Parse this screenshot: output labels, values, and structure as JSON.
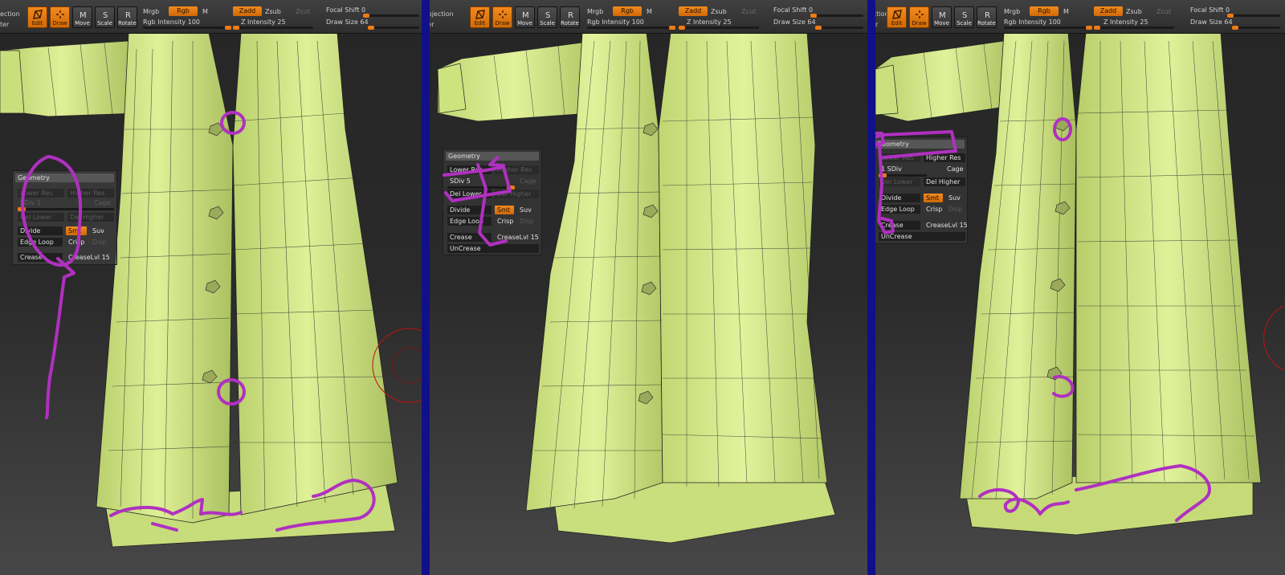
{
  "toolbar": {
    "projection": "ection",
    "projection_line2": "ter",
    "tools": {
      "edit": "Edit",
      "draw": "Draw",
      "move": "Move",
      "scale": "Scale",
      "rotate": "Rotate"
    },
    "mrgb": "Mrgb",
    "rgb": "Rgb",
    "m": "M",
    "zadd": "Zadd",
    "zsub": "Zsub",
    "zcut": "Zcut",
    "rgb_intensity": "Rgb Intensity 100",
    "z_intensity": "Z Intensity 25",
    "focal_shift": "Focal Shift 0",
    "draw_size": "Draw Size 64"
  },
  "panel2": {
    "projection": "Projection",
    "projection_line2": "ster"
  },
  "geometry": {
    "title": "Geometry",
    "lower_res": "Lower Res",
    "higher_res": "Higher Res",
    "cage": "Cage",
    "del_lower": "Del Lower",
    "del_higher": "Del Higher",
    "divide": "Divide",
    "smt": "Smt",
    "suv": "Suv",
    "edge_loop": "Edge Loop",
    "crisp": "Crisp",
    "disp": "Disp",
    "crease": "Crease",
    "crease_lvl": "CreaseLvl 15",
    "uncrease": "UnCrease"
  },
  "panels": [
    {
      "sdiv": "SDiv 1"
    },
    {
      "sdiv": "SDiv 5"
    },
    {
      "sdiv": "1 SDiv"
    }
  ],
  "colors": {
    "coat": "#d6ec8a",
    "annotation": "#b030c0",
    "accent": "#f28a1e",
    "divider": "#10108a"
  }
}
